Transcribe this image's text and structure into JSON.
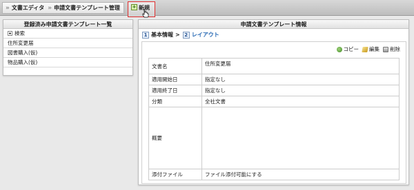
{
  "breadcrumb": {
    "items": [
      "文書エディタ",
      "申請文書テンプレート管理"
    ]
  },
  "toolbar": {
    "new_label": "新規"
  },
  "left_panel": {
    "title": "登録済み申請文書テンプレート一覧",
    "search_label": "検索",
    "items": [
      "住所変更届",
      "図書購入(仮)",
      "物品購入(仮)"
    ]
  },
  "right_panel": {
    "title": "申請文書テンプレート情報",
    "steps": [
      {
        "num": "1",
        "label": "基本情報"
      },
      {
        "num": "2",
        "label": "レイアウト"
      }
    ],
    "actions": {
      "copy": "コピー",
      "edit": "編集",
      "delete": "削除"
    },
    "fields": [
      {
        "key": "文書名",
        "value": "住所変更届"
      },
      {
        "key": "適用開始日",
        "value": "指定なし"
      },
      {
        "key": "適用終了日",
        "value": "指定なし"
      },
      {
        "key": "分類",
        "value": "全社文書"
      },
      {
        "key": "概要",
        "value": ""
      },
      {
        "key": "添付ファイル",
        "value": "ファイル添付可能にする"
      }
    ]
  }
}
